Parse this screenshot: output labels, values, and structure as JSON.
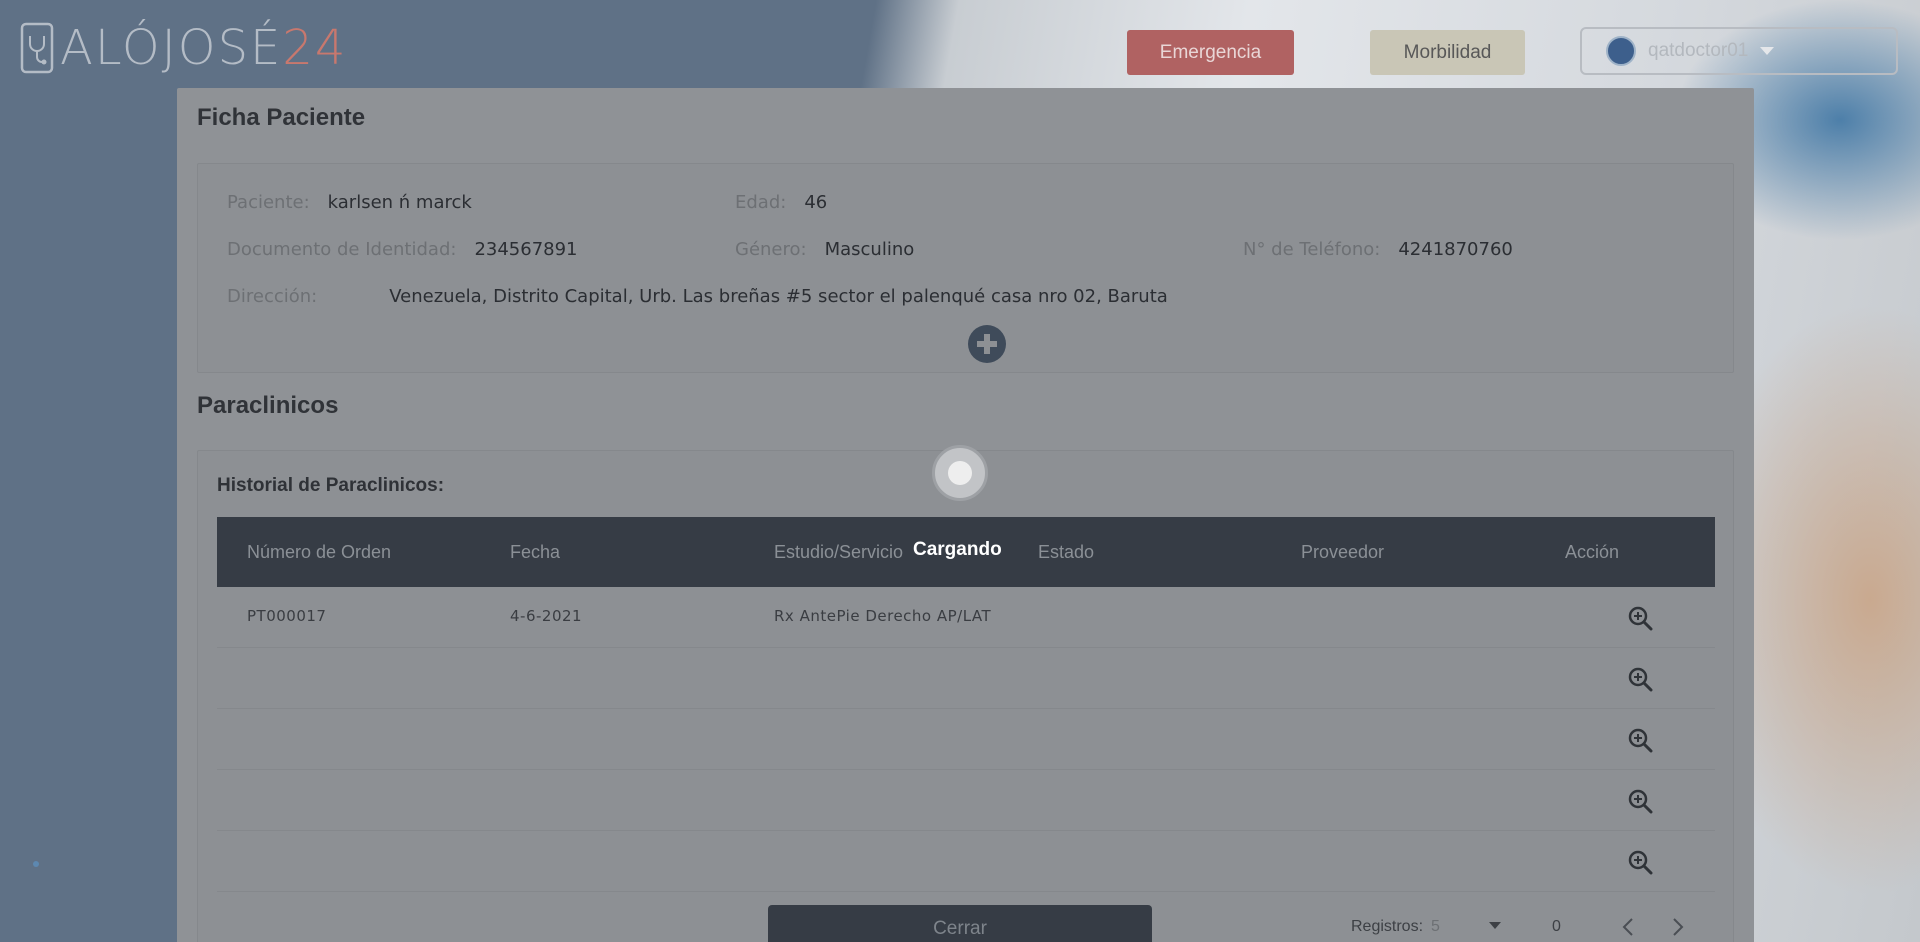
{
  "brand": {
    "logo_main": "ALÓJOSÉ",
    "logo_num": "24"
  },
  "header": {
    "emergency_label": "Emergencia",
    "morbilidad_label": "Morbilidad",
    "user_name": "qatdoctor01"
  },
  "ficha": {
    "title": "Ficha Paciente",
    "paciente_label": "Paciente:",
    "paciente_value": "karlsen ń marck",
    "edad_label": "Edad:",
    "edad_value": "46",
    "documento_label": "Documento de Identidad:",
    "documento_value": "234567891",
    "genero_label": "Género:",
    "genero_value": "Masculino",
    "telefono_label": "N° de Teléfono:",
    "telefono_value": "4241870760",
    "direccion_label": "Dirección:",
    "direccion_value": "Venezuela, Distrito Capital, Urb. Las breñas #5 sector el palenqué casa nro 02, Baruta"
  },
  "paraclinicos": {
    "title": "Paraclinicos",
    "historial_title": "Historial de Paraclinicos:",
    "columns": [
      "Número de Orden",
      "Fecha",
      "Estudio/Servicio",
      "Estado",
      "Proveedor",
      "Acción"
    ],
    "rows": [
      {
        "orden": "PT000017",
        "fecha": "4-6-2021",
        "estudio": "Rx AntePie Derecho AP/LAT",
        "estado": "",
        "proveedor": ""
      },
      {
        "orden": "",
        "fecha": "",
        "estudio": "",
        "estado": "",
        "proveedor": ""
      },
      {
        "orden": "",
        "fecha": "",
        "estudio": "",
        "estado": "",
        "proveedor": ""
      },
      {
        "orden": "",
        "fecha": "",
        "estudio": "",
        "estado": "",
        "proveedor": ""
      },
      {
        "orden": "",
        "fecha": "",
        "estudio": "",
        "estado": "",
        "proveedor": ""
      }
    ],
    "close_label": "Cerrar",
    "registros_label": "Registros:",
    "registros_value": "5",
    "range_text": "0"
  },
  "loader": {
    "text": "Cargando"
  },
  "icons": {
    "add": "plus-circle-icon",
    "zoom": "zoom-in-icon",
    "prev": "chevron-left-icon",
    "next": "chevron-right-icon"
  },
  "colors": {
    "emergency": "#b06262",
    "morbilidad": "#c9c6b6",
    "table_header": "#363c45",
    "logo_accent": "#c8786e"
  }
}
